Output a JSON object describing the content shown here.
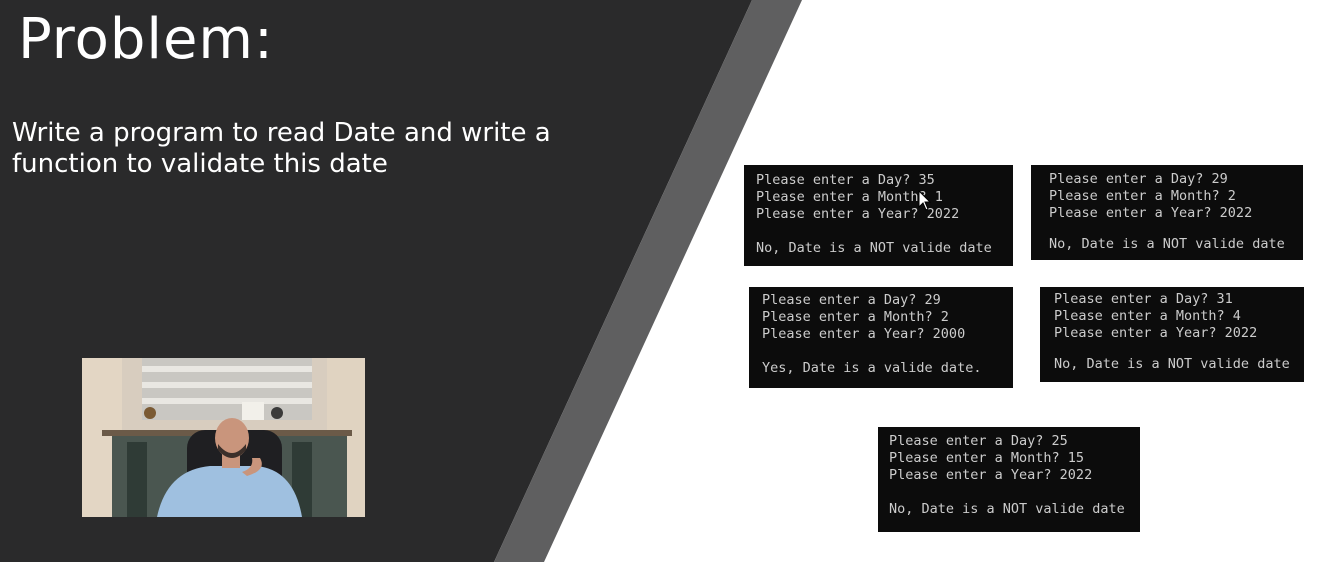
{
  "slide": {
    "title": "Problem:",
    "description": "Write a program to read Date and write a\nfunction to validate this date",
    "colors": {
      "dark_panel": "#2a2a2b",
      "stripe": "#5f5f60",
      "console_bg": "#0c0c0c",
      "console_text": "#cccccc"
    }
  },
  "video": {
    "icon": "presenter-webcam"
  },
  "consoles": [
    {
      "lines": [
        "Please enter a Day? 35",
        "Please enter a Month? 1",
        "Please enter a Year? 2022",
        "",
        "No, Date is a NOT valide date"
      ]
    },
    {
      "lines": [
        "Please enter a Day? 29",
        "Please enter a Month? 2",
        "Please enter a Year? 2022",
        "",
        "No, Date is a NOT valide date"
      ]
    },
    {
      "lines": [
        "Please enter a Day? 29",
        "Please enter a Month? 2",
        "Please enter a Year? 2000",
        "",
        "Yes, Date is a valide date."
      ]
    },
    {
      "lines": [
        "Please enter a Day? 31",
        "Please enter a Month? 4",
        "Please enter a Year? 2022",
        "",
        "No, Date is a NOT valide date"
      ]
    },
    {
      "lines": [
        "Please enter a Day? 25",
        "Please enter a Month? 15",
        "Please enter a Year? 2022",
        "",
        "No, Date is a NOT valide date"
      ]
    }
  ],
  "cursor": {
    "icon": "mouse-pointer-icon"
  }
}
